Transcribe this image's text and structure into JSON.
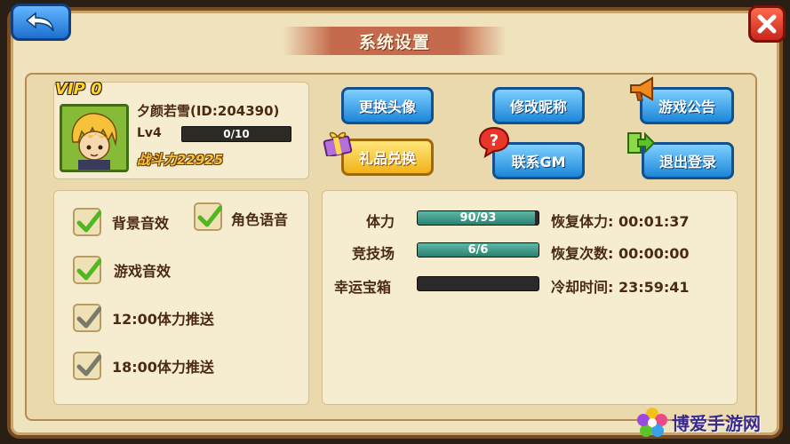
{
  "header": {
    "title": "系统设置"
  },
  "profile": {
    "vip": "VIP 0",
    "name": "夕颜若雪(ID:204390)",
    "level": "Lv4",
    "exp_text": "0/10",
    "exp_fraction": 0,
    "combat_power": "战斗力22925"
  },
  "actions": {
    "change_avatar": "更换头像",
    "change_nickname": "修改昵称",
    "announcement": "游戏公告",
    "gift_redeem": "礼品兑换",
    "contact_gm": "联系GM",
    "logout": "退出登录"
  },
  "settings": [
    {
      "label": "背景音效",
      "checked": true,
      "style": "green"
    },
    {
      "label": "角色语音",
      "checked": true,
      "style": "green"
    },
    {
      "label": "游戏音效",
      "checked": true,
      "style": "green"
    },
    {
      "label": "12:00体力推送",
      "checked": true,
      "style": "gray"
    },
    {
      "label": "18:00体力推送",
      "checked": true,
      "style": "gray"
    }
  ],
  "stats": [
    {
      "label": "体力",
      "bar_text": "90/93",
      "fraction": 0.968,
      "info": "恢复体力: 00:01:37"
    },
    {
      "label": "竞技场",
      "bar_text": "6/6",
      "fraction": 1.0,
      "info": "恢复次数: 00:00:00"
    },
    {
      "label": "幸运宝箱",
      "bar_text": "",
      "fraction": 0,
      "info": "冷却时间: 23:59:41"
    }
  ],
  "watermark": {
    "text": "博爱手游网"
  },
  "colors": {
    "panel": "#f6ecd0",
    "frame": "#efe3bd",
    "button_blue": "#1d86d8",
    "button_yellow": "#f0b21a",
    "bar_fill": "#2a8070",
    "text": "#4a2b12"
  }
}
